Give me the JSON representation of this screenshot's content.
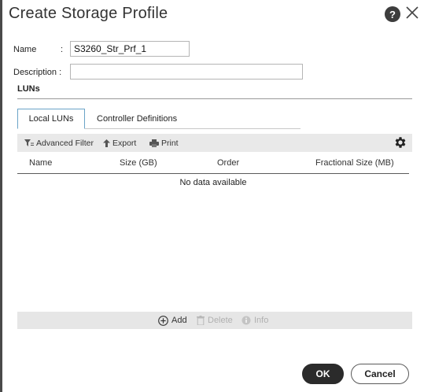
{
  "dialog": {
    "title": "Create Storage Profile",
    "help_label": "?",
    "close_icon": "close-icon"
  },
  "form": {
    "name_label": "Name",
    "name_colon": ":",
    "name_value": "S3260_Str_Prf_1",
    "description_label": "Description :",
    "description_value": ""
  },
  "section": {
    "title": "LUNs"
  },
  "tabs": [
    {
      "label": "Local LUNs",
      "active": true
    },
    {
      "label": "Controller Definitions",
      "active": false
    }
  ],
  "toolbar": {
    "advanced_filter": "Advanced Filter",
    "export": "Export",
    "print": "Print",
    "settings_icon": "gear-icon"
  },
  "table": {
    "columns": [
      "Name",
      "Size (GB)",
      "Order",
      "Fractional Size (MB)"
    ],
    "empty_message": "No data available",
    "rows": []
  },
  "table_actions": {
    "add": "Add",
    "delete": "Delete",
    "info": "Info"
  },
  "buttons": {
    "ok": "OK",
    "cancel": "Cancel"
  },
  "colors": {
    "primary_button": "#2b2b2b",
    "active_tab_border": "#6aa3c7",
    "toolbar_bg": "#e9e9e9"
  }
}
